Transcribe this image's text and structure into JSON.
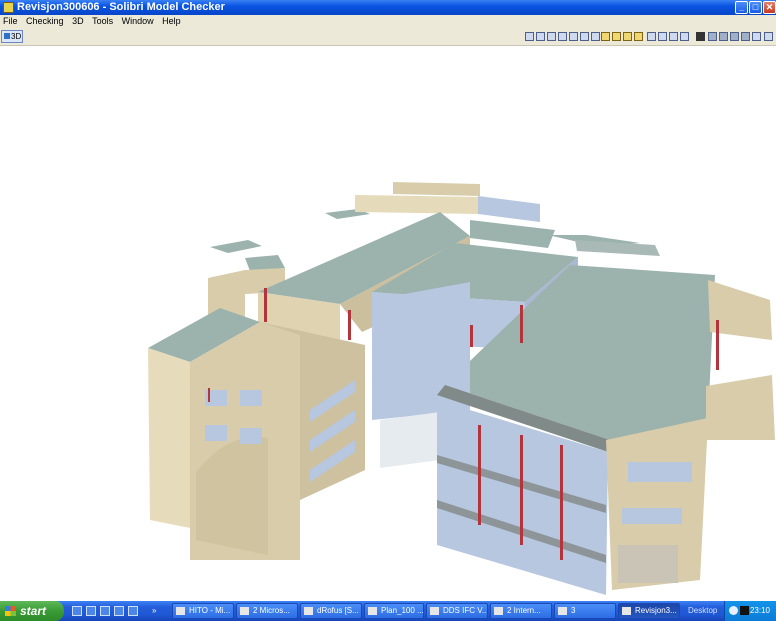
{
  "window": {
    "title": "Revisjon300606 - Solibri Model Checker",
    "minimize": "_",
    "maximize": "□",
    "close": "✕"
  },
  "menu": [
    "File",
    "Checking",
    "3D",
    "Tools",
    "Window",
    "Help"
  ],
  "toolbar": {
    "view_3d": "3D"
  },
  "taskbar": {
    "start": "start",
    "desktop": "Desktop",
    "clock": "23:10",
    "overflow": "»",
    "tasks": [
      "HITO - Mi...",
      "2 Micros...",
      "dRofus [S...",
      "Plan_100 ...",
      "DDS IFC V...",
      "2 Intern...",
      "3",
      "Revisjon3..."
    ]
  },
  "colors": {
    "wall": "#d8ccaa",
    "roof": "#9cb2ad",
    "glass": "#b7c7e0",
    "mullion": "#b3343a",
    "title": "#0a54e3"
  }
}
